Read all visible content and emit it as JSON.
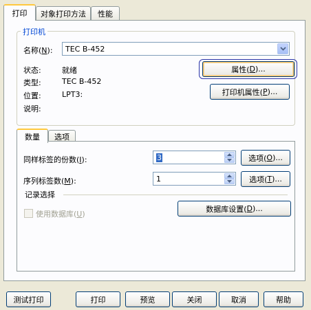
{
  "tabs": {
    "print": "打印",
    "object_print": "对象打印方法",
    "performance": "性能"
  },
  "printer_group": {
    "title": "打印机",
    "name_label": "名称(N):",
    "name_value": "TEC B-452",
    "status_label": "状态:",
    "status_value": "就绪",
    "type_label": "类型:",
    "type_value": "TEC B-452",
    "location_label": "位置:",
    "location_value": "LPT3:",
    "comment_label": "说明:",
    "properties_button": "属性(D)...",
    "printer_properties_button": "打印机属性(P)..."
  },
  "inner_tabs": {
    "quantity": "数量",
    "options": "选项"
  },
  "quantity": {
    "copies_label": "同样标签的份数(I):",
    "copies_value": "3",
    "copies_options_button": "选项(O)...",
    "serial_label": "序列标签数(M):",
    "serial_value": "1",
    "serial_options_button": "选项(T)...",
    "record_section": "记录选择",
    "use_database_label": "使用数据库(U)",
    "database_settings_button": "数据库设置(D)..."
  },
  "footer": {
    "test_print": "测试打印",
    "print": "打印",
    "preview": "预览",
    "close": "关闭",
    "cancel": "取消",
    "help": "帮助"
  }
}
